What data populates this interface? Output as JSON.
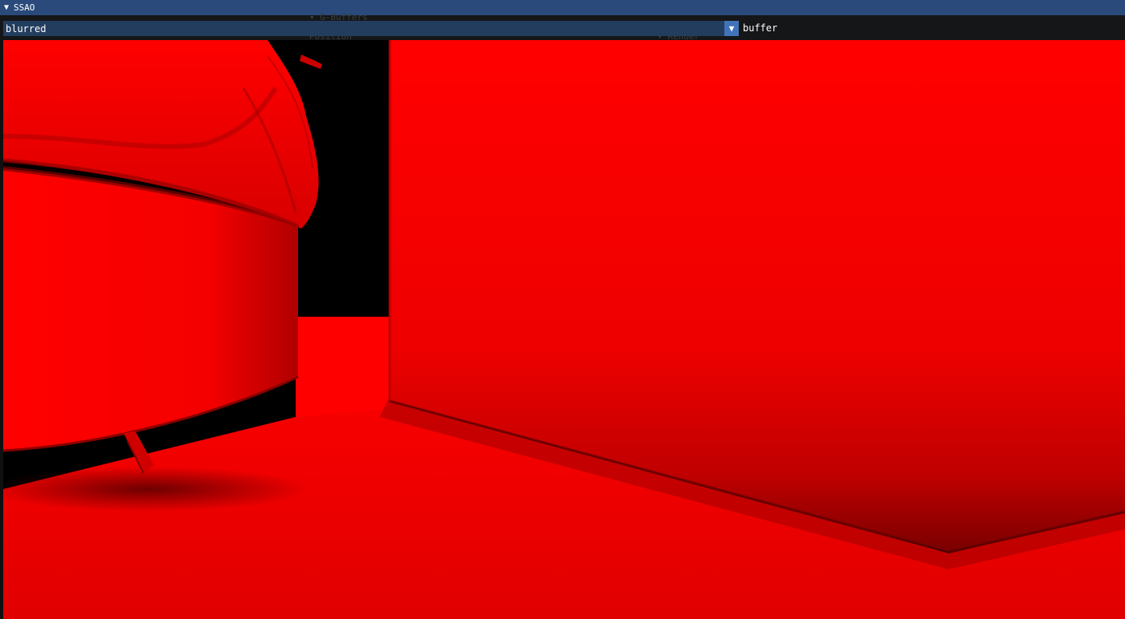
{
  "window": {
    "title": "SSAO",
    "collapse_icon": "triangle-down-icon"
  },
  "buffer_select": {
    "selected": "blurred",
    "label": "buffer",
    "arrow_icon": "triangle-down-icon"
  },
  "background_ghost": {
    "item1": "▾ G-Buffers",
    "item2": "Position",
    "item3": "▾ Render"
  },
  "viewport": {
    "description_colors": {
      "base": "#ff0000",
      "shadow": "#7a0000",
      "background": "#000000"
    }
  }
}
